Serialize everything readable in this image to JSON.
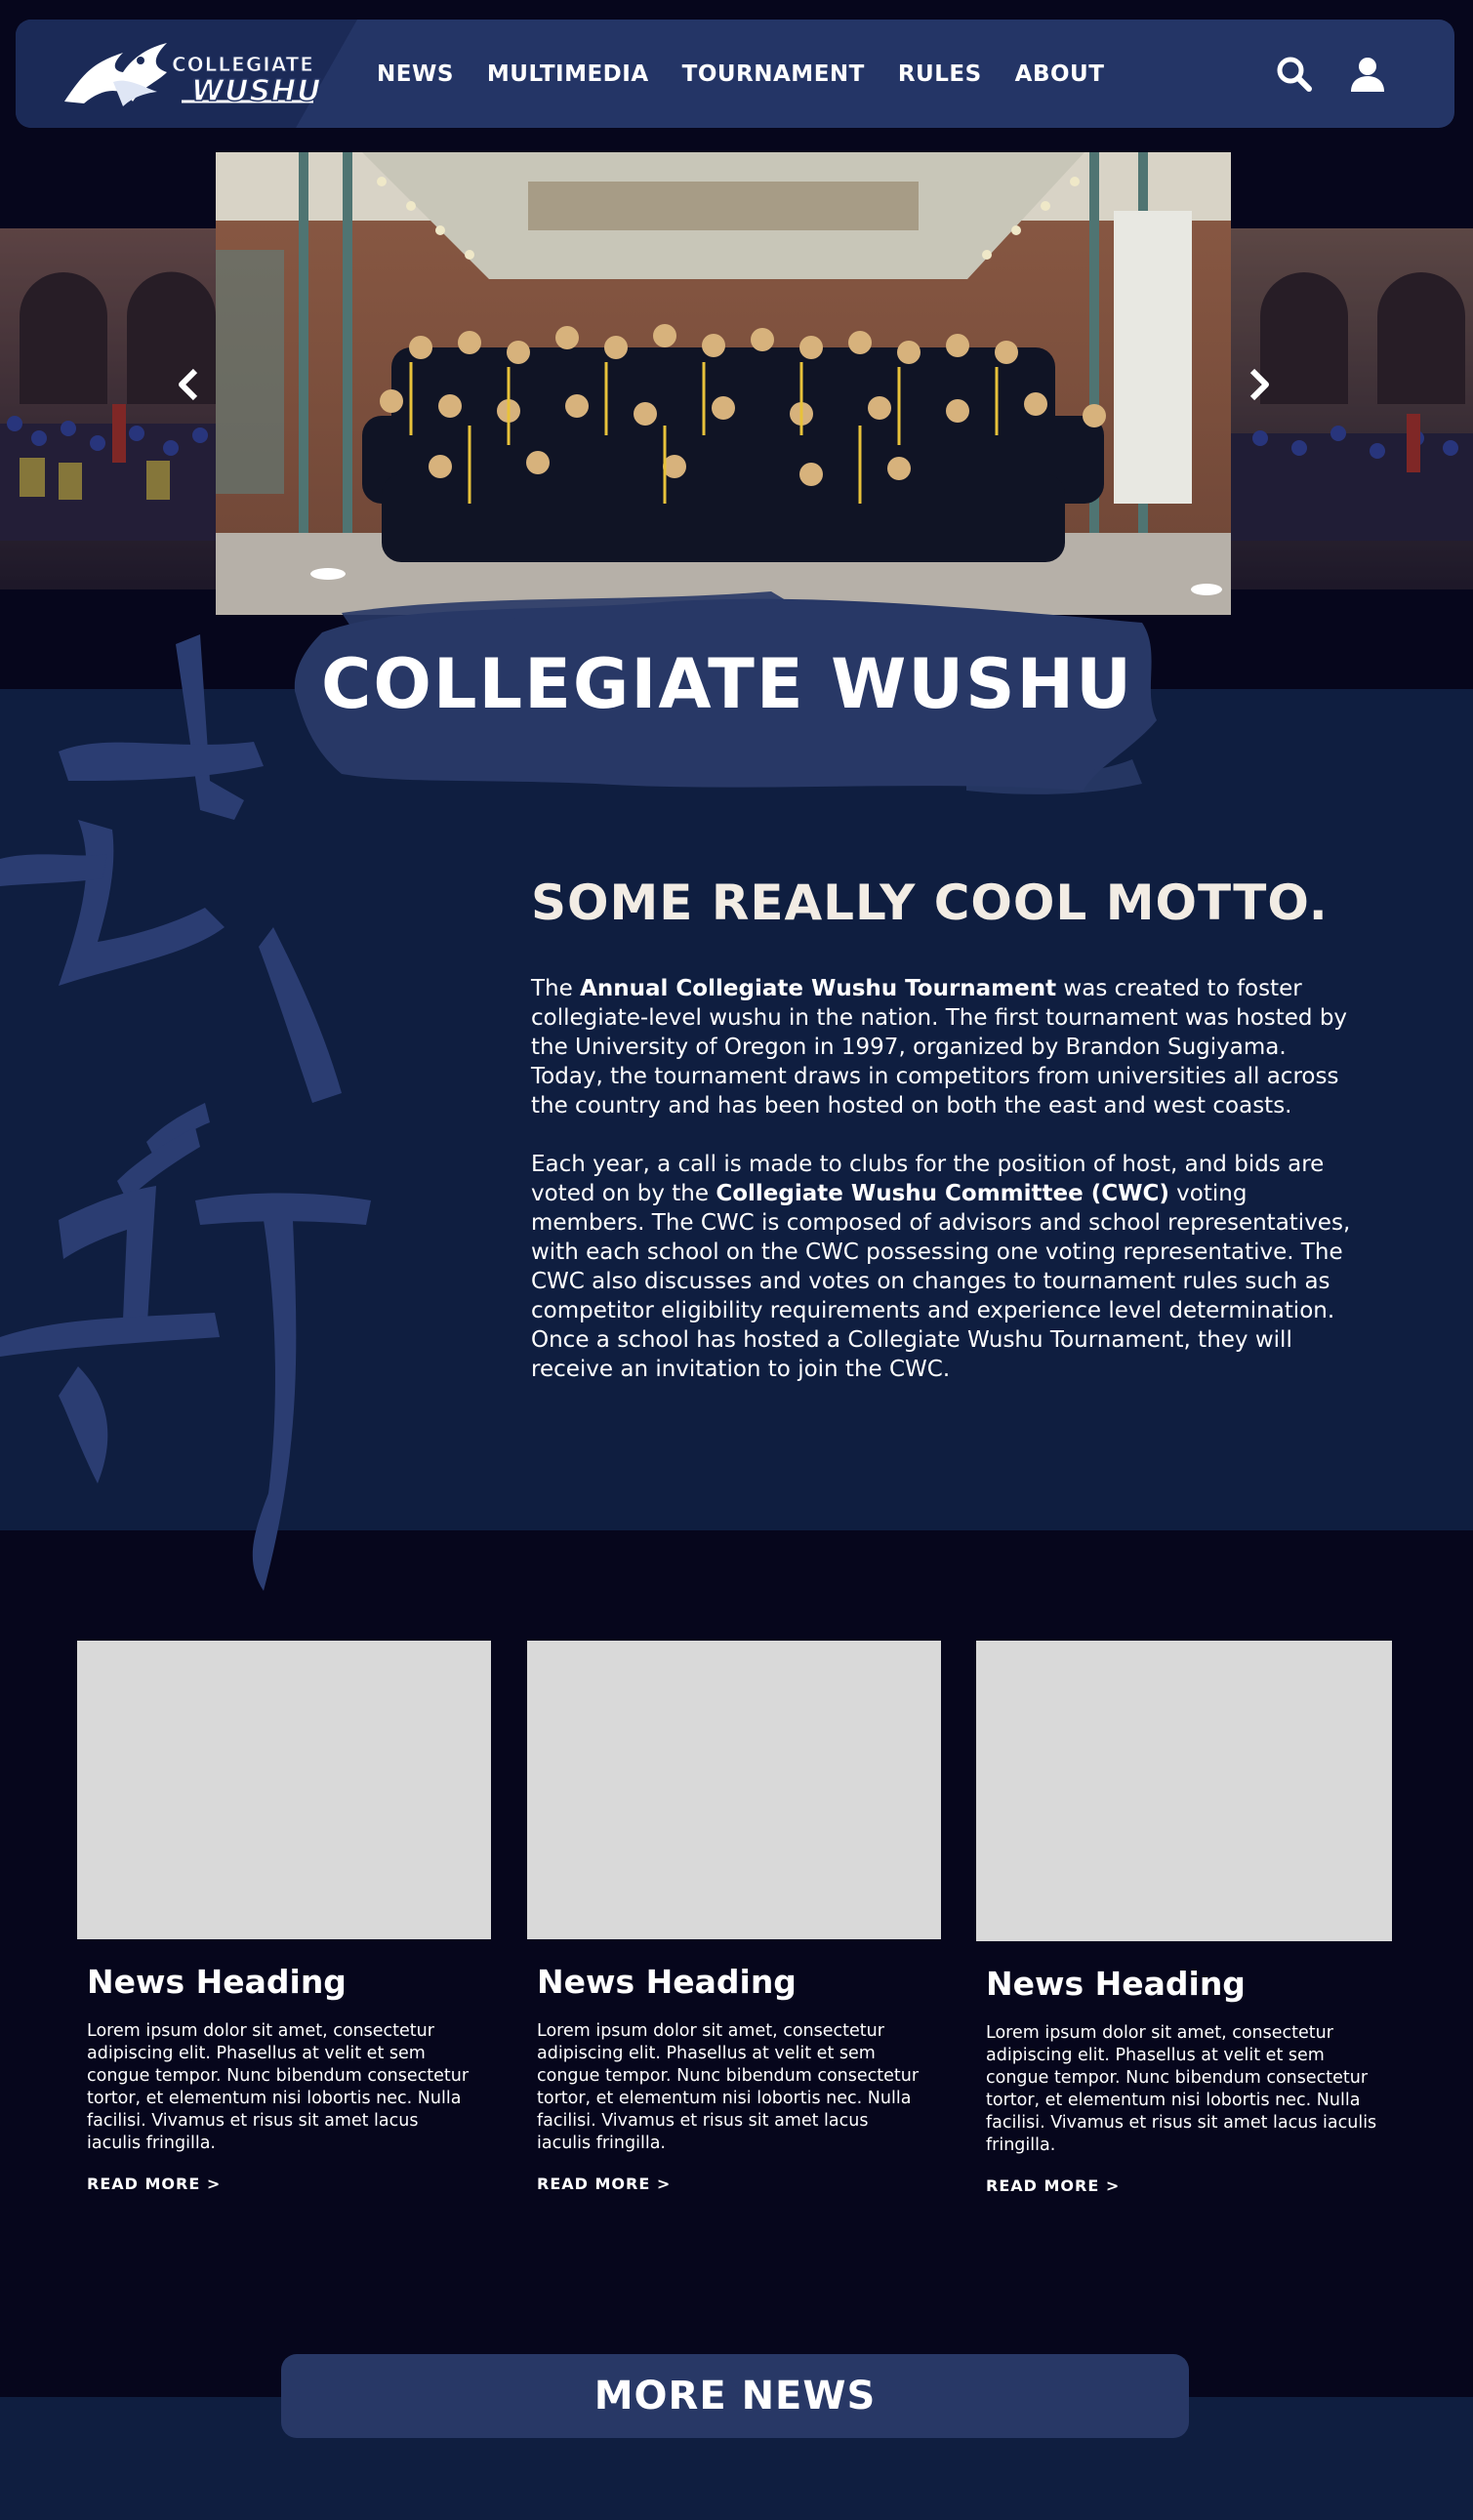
{
  "logo": {
    "text_top": "COLLEGIATE",
    "text_main": "WUSHU"
  },
  "nav": {
    "items": [
      {
        "label": "NEWS"
      },
      {
        "label": "MULTIMEDIA"
      },
      {
        "label": "TOURNAMENT"
      },
      {
        "label": "RULES"
      },
      {
        "label": "ABOUT"
      }
    ],
    "icons": [
      "search-icon",
      "user-icon"
    ]
  },
  "hero": {
    "prev_icon": "chevron-left-icon",
    "next_icon": "chevron-right-icon",
    "title": "COLLEGIATE WUSHU"
  },
  "about": {
    "motto": "SOME REALLY COOL MOTTO.",
    "para1_pre": "The ",
    "para1_bold": "Annual Collegiate Wushu Tournament",
    "para1_post": " was created to foster collegiate-level wushu in the nation. The first tournament was hosted by the University of Oregon in 1997, organized by Brandon Sugiyama. Today, the tournament draws in competitors from universities all across the country and has been hosted on both the east and west coasts.",
    "para2_pre": "Each year, a call is made to clubs for the position of host, and bids are voted on by the ",
    "para2_bold": "Collegiate Wushu Committee (CWC)",
    "para2_post": " voting members. The CWC is composed of advisors and school representatives, with each school on the CWC possessing one voting representative. The CWC also discusses and votes on changes to tournament rules such as competitor eligibility requirements and experience level determination. Once a school has hosted a Collegiate Wushu Tournament, they will receive an invitation to join the CWC."
  },
  "news": {
    "cards": [
      {
        "heading": "News Heading",
        "body": "Lorem ipsum dolor sit amet, consectetur adipiscing elit. Phasellus at velit et sem congue tempor. Nunc bibendum consectetur tortor, et elementum nisi lobortis nec. Nulla facilisi. Vivamus et risus sit amet lacus iaculis fringilla.",
        "link": "READ MORE >"
      },
      {
        "heading": "News Heading",
        "body": "Lorem ipsum dolor sit amet, consectetur adipiscing elit. Phasellus at velit et sem congue tempor. Nunc bibendum consectetur tortor, et elementum nisi lobortis nec. Nulla facilisi. Vivamus et risus sit amet lacus iaculis fringilla.",
        "link": "READ MORE >"
      },
      {
        "heading": "News Heading",
        "body": "Lorem ipsum dolor sit amet, consectetur adipiscing elit. Phasellus at velit et sem congue tempor. Nunc bibendum consectetur tortor, et elementum nisi lobortis nec. Nulla facilisi. Vivamus et risus sit amet lacus iaculis fringilla.",
        "link": "READ MORE >"
      }
    ],
    "more_button": "MORE NEWS"
  },
  "colors": {
    "page_bg": "#06061c",
    "section_bg": "#0f1e40",
    "nav_bg": "#243566",
    "accent": "#283866",
    "placeholder": "#d9d9d9"
  }
}
